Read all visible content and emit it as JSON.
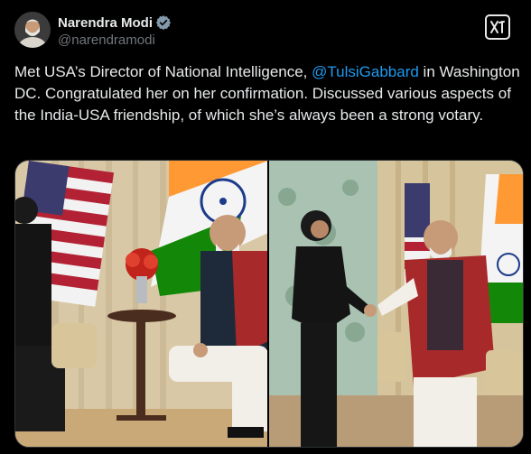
{
  "author": {
    "display_name": "Narendra Modi",
    "handle": "@narendramodi",
    "verified": true,
    "avatar_icon": "profile-photo"
  },
  "actions": {
    "grok_icon": "grok-logo-icon"
  },
  "tweet": {
    "text_before": "Met USA’s Director of National Intelligence, ",
    "mention": "@TulsiGabbard",
    "text_after": " in Washington DC. Congratulated her on her confirmation. Discussed various aspects of the India-USA friendship, of which she’s always been a strong votary."
  },
  "colors": {
    "background": "#000000",
    "text": "#e7e9ea",
    "secondary": "#71767b",
    "link": "#1d9bf0",
    "verified_badge": "#829aab"
  },
  "media": {
    "photos": [
      {
        "name": "meeting-seated-photo"
      },
      {
        "name": "handshake-photo"
      }
    ]
  }
}
